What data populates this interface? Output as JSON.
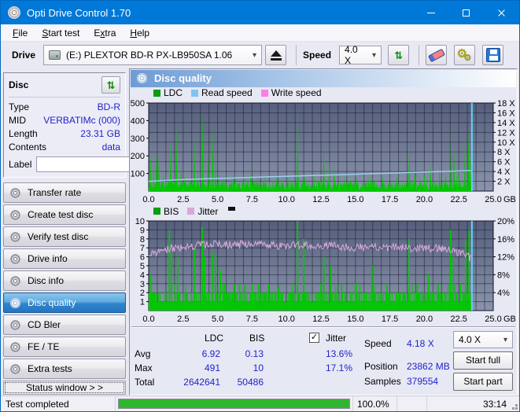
{
  "titlebar": {
    "title": "Opti Drive Control 1.70"
  },
  "menu": {
    "items": [
      {
        "pre": "",
        "u": "F",
        "rest": "ile"
      },
      {
        "pre": "",
        "u": "S",
        "rest": "tart test"
      },
      {
        "pre": "E",
        "u": "x",
        "rest": "tra"
      },
      {
        "pre": "",
        "u": "H",
        "rest": "elp"
      }
    ]
  },
  "toolbar": {
    "drive_label": "Drive",
    "drive_value": "(E:)   PLEXTOR BD-R  PX-LB950SA 1.06",
    "speed_label": "Speed",
    "speed_value": "4.0 X"
  },
  "sidebar": {
    "disc_panel": {
      "title": "Disc",
      "rows": [
        {
          "label": "Type",
          "value": "BD-R"
        },
        {
          "label": "MID",
          "value": "VERBATIMc (000)"
        },
        {
          "label": "Length",
          "value": "23.31 GB"
        },
        {
          "label": "Contents",
          "value": "data"
        }
      ],
      "label_label": "Label",
      "label_value": ""
    },
    "nav": [
      {
        "label": "Transfer rate",
        "selected": false
      },
      {
        "label": "Create test disc",
        "selected": false
      },
      {
        "label": "Verify test disc",
        "selected": false
      },
      {
        "label": "Drive info",
        "selected": false
      },
      {
        "label": "Disc info",
        "selected": false
      },
      {
        "label": "Disc quality",
        "selected": true
      },
      {
        "label": "CD Bler",
        "selected": false
      },
      {
        "label": "FE / TE",
        "selected": false
      },
      {
        "label": "Extra tests",
        "selected": false
      }
    ],
    "status_window_button": "Status window > >"
  },
  "main": {
    "header": "Disc quality",
    "stats": {
      "col_ldc": "LDC",
      "col_bis": "BIS",
      "jitter_label": "Jitter",
      "jitter_checked": true,
      "rows": [
        {
          "label": "Avg",
          "ldc": "6.92",
          "bis": "0.13",
          "jitter": "13.6%"
        },
        {
          "label": "Max",
          "ldc": "491",
          "bis": "10",
          "jitter": "17.1%"
        },
        {
          "label": "Total",
          "ldc": "2642641",
          "bis": "50486",
          "jitter": ""
        }
      ],
      "speed_label": "Speed",
      "speed_value": "4.18 X",
      "position_label": "Position",
      "position_value": "23862 MB",
      "samples_label": "Samples",
      "samples_value": "379554",
      "speed_select": "4.0 X",
      "start_full": "Start full",
      "start_part": "Start part"
    }
  },
  "statusbar": {
    "status": "Test completed",
    "progress_pct": "100.0%",
    "time": "33:14"
  },
  "colors": {
    "accent": "#0078D7",
    "value_text": "#2222CC",
    "ldc_green": "#00C800",
    "bis_green": "#00C800",
    "read_speed_line": "#9AD0F0",
    "jitter_line": "#D9A9DC",
    "cursor": "#5FD2F8",
    "legend_ldc": "#0A9E0A",
    "legend_read": "#7FC4EE",
    "legend_write": "#FF7DEB",
    "legend_bis": "#0A9E0A",
    "legend_jitter": "#D8A8D8",
    "progress_green": "#2FB52F"
  },
  "chart_data": [
    {
      "type": "area",
      "title": "LDC / Read speed",
      "legend": [
        {
          "label": "LDC"
        },
        {
          "label": "Read speed"
        },
        {
          "label": "Write speed"
        }
      ],
      "x_range": [
        0,
        25
      ],
      "x_unit": "GB",
      "x_ticks": [
        "0.0",
        "2.5",
        "5.0",
        "7.5",
        "10.0",
        "12.5",
        "15.0",
        "17.5",
        "20.0",
        "22.5",
        "25.0"
      ],
      "y_left_range": [
        0,
        500
      ],
      "y_left_ticks": [
        500,
        400,
        300,
        200,
        100
      ],
      "y_right_range": [
        0,
        18
      ],
      "y_right_ticks": [
        18,
        16,
        14,
        12,
        10,
        8,
        6,
        4,
        2
      ],
      "y_right_suffix": " X",
      "grid_cols": 40,
      "grid_rows": 9,
      "data_end": 23.45,
      "baseline_max": 58,
      "ldc_spikes": [
        [
          0.15,
          215
        ],
        [
          0.35,
          140
        ],
        [
          0.55,
          215
        ],
        [
          0.75,
          230
        ],
        [
          1.05,
          120
        ],
        [
          1.6,
          305
        ],
        [
          2.0,
          405
        ],
        [
          2.35,
          150
        ],
        [
          2.6,
          90
        ],
        [
          3.3,
          350
        ],
        [
          3.55,
          120
        ],
        [
          3.9,
          455
        ],
        [
          4.3,
          235
        ],
        [
          4.65,
          370
        ],
        [
          4.85,
          185
        ],
        [
          5.1,
          110
        ],
        [
          5.45,
          95
        ],
        [
          6.2,
          100
        ],
        [
          6.9,
          85
        ],
        [
          7.4,
          110
        ],
        [
          7.9,
          90
        ],
        [
          8.45,
          95
        ],
        [
          9.3,
          90
        ],
        [
          10.1,
          85
        ],
        [
          10.8,
          490
        ],
        [
          11.3,
          100
        ],
        [
          12.0,
          90
        ],
        [
          12.7,
          295
        ],
        [
          13.1,
          195
        ],
        [
          13.45,
          160
        ],
        [
          14.2,
          90
        ],
        [
          15.1,
          85
        ],
        [
          16.1,
          95
        ],
        [
          17.0,
          90
        ],
        [
          18.0,
          100
        ],
        [
          18.9,
          265
        ],
        [
          19.3,
          120
        ],
        [
          20.0,
          110
        ],
        [
          20.45,
          155
        ],
        [
          21.1,
          145
        ],
        [
          21.55,
          120
        ],
        [
          21.95,
          350
        ],
        [
          22.15,
          235
        ],
        [
          22.5,
          130
        ],
        [
          22.95,
          300
        ],
        [
          23.2,
          350
        ],
        [
          23.35,
          200
        ]
      ],
      "read_speed": [
        [
          0,
          2.0
        ],
        [
          2,
          2.3
        ],
        [
          4,
          2.5
        ],
        [
          6,
          2.65
        ],
        [
          8,
          2.85
        ],
        [
          10,
          3.0
        ],
        [
          12,
          3.2
        ],
        [
          14,
          3.35
        ],
        [
          16,
          3.55
        ],
        [
          18,
          3.7
        ],
        [
          20,
          3.9
        ],
        [
          22,
          4.05
        ],
        [
          23.45,
          4.18
        ]
      ]
    },
    {
      "type": "bar",
      "title": "BIS / Jitter",
      "legend": [
        {
          "label": "BIS"
        },
        {
          "label": "Jitter"
        }
      ],
      "x_range": [
        0,
        25
      ],
      "x_unit": "GB",
      "x_ticks": [
        "0.0",
        "2.5",
        "5.0",
        "7.5",
        "10.0",
        "12.5",
        "15.0",
        "17.5",
        "20.0",
        "22.5",
        "25.0"
      ],
      "y_left_range": [
        0,
        10
      ],
      "y_left_ticks": [
        10,
        9,
        8,
        7,
        6,
        5,
        4,
        3,
        2,
        1
      ],
      "y_right_range": [
        0,
        20
      ],
      "y_right_ticks": [
        20,
        16,
        12,
        8,
        4
      ],
      "y_right_suffix": "%",
      "grid_cols": 40,
      "grid_rows": 10,
      "data_end": 23.45,
      "bis_spikes": [
        [
          0.15,
          4
        ],
        [
          1.5,
          9
        ],
        [
          1.65,
          6.5
        ],
        [
          2.1,
          6
        ],
        [
          3.3,
          7
        ],
        [
          3.9,
          9.3
        ],
        [
          4.05,
          6
        ],
        [
          4.65,
          6.5
        ],
        [
          4.85,
          6.2
        ],
        [
          5.2,
          4.5
        ],
        [
          5.5,
          3
        ],
        [
          6.2,
          3
        ],
        [
          6.6,
          3
        ],
        [
          7.0,
          3
        ],
        [
          7.5,
          3
        ],
        [
          8.0,
          3
        ],
        [
          8.7,
          3
        ],
        [
          9.4,
          2.5
        ],
        [
          10.8,
          10
        ],
        [
          11.25,
          8
        ],
        [
          12.7,
          6
        ],
        [
          13.2,
          5
        ],
        [
          14.0,
          3
        ],
        [
          15.0,
          3
        ],
        [
          16.2,
          5
        ],
        [
          17.3,
          3
        ],
        [
          18.9,
          8
        ],
        [
          19.5,
          3
        ],
        [
          20.3,
          4
        ],
        [
          21.0,
          3
        ],
        [
          21.9,
          9
        ],
        [
          22.1,
          6
        ],
        [
          22.6,
          3
        ],
        [
          23.0,
          8
        ],
        [
          23.25,
          9
        ]
      ],
      "jitter": [
        [
          0,
          6.0
        ],
        [
          0.5,
          6.5
        ],
        [
          1,
          6.8
        ],
        [
          2,
          7.0
        ],
        [
          3,
          7.2
        ],
        [
          4,
          7.3
        ],
        [
          5,
          7.4
        ],
        [
          6,
          7.3
        ],
        [
          7,
          7.4
        ],
        [
          8,
          7.5
        ],
        [
          9,
          7.3
        ],
        [
          10,
          7.2
        ],
        [
          11,
          7.3
        ],
        [
          12,
          7.2
        ],
        [
          13,
          7.3
        ],
        [
          14,
          7.1
        ],
        [
          15,
          7.0
        ],
        [
          16,
          7.1
        ],
        [
          17,
          7.0
        ],
        [
          18,
          7.1
        ],
        [
          19,
          6.9
        ],
        [
          20,
          7.0
        ],
        [
          21,
          6.9
        ],
        [
          22,
          6.8
        ],
        [
          22.8,
          6.3
        ],
        [
          23.3,
          5.9
        ]
      ]
    }
  ]
}
